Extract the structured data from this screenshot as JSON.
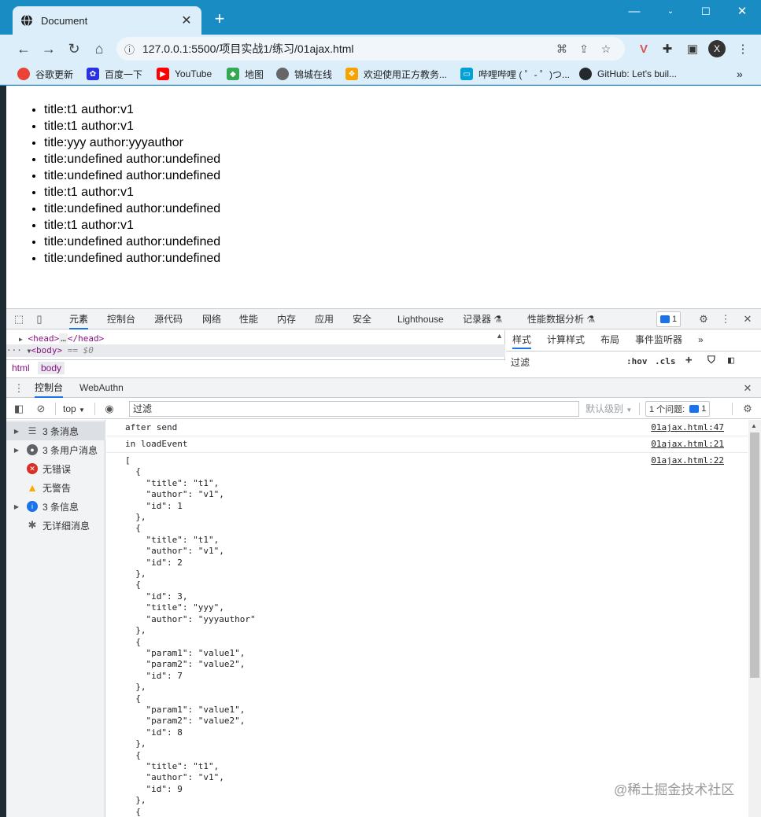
{
  "browser": {
    "tab_title": "Document",
    "tab_close": "✕",
    "new_tab": "+",
    "window_controls": {
      "minimize": "—",
      "maximize": "☐",
      "close": "✕"
    },
    "url": "127.0.0.1:5500/项目实战1/练习/01ajax.html",
    "profile_initial": "X",
    "bookmarks": [
      {
        "label": "谷歌更新"
      },
      {
        "label": "百度一下"
      },
      {
        "label": "YouTube"
      },
      {
        "label": "地图"
      },
      {
        "label": "锦城在线"
      },
      {
        "label": "欢迎使用正方教务..."
      },
      {
        "label": "哔哩哔哩 ( ゜- ゜)つ..."
      },
      {
        "label": "GitHub: Let's buil..."
      }
    ],
    "bookmarks_more": "»"
  },
  "page": {
    "items": [
      "title:t1 author:v1",
      "title:t1 author:v1",
      "title:yyy author:yyyauthor",
      "title:undefined author:undefined",
      "title:undefined author:undefined",
      "title:t1 author:v1",
      "title:undefined author:undefined",
      "title:t1 author:v1",
      "title:undefined author:undefined",
      "title:undefined author:undefined"
    ]
  },
  "devtools": {
    "tabs": [
      "元素",
      "控制台",
      "源代码",
      "网络",
      "性能",
      "内存",
      "应用",
      "安全",
      "Lighthouse",
      "记录器 ⚗",
      "性能数据分析 ⚗"
    ],
    "issues_count": "1",
    "elements": {
      "head_line_open": "<head>",
      "head_line_ellipsis": "…",
      "head_line_close": "</head>",
      "body_prefix": "···",
      "body_tag": "<body>",
      "body_suffix": "== $0",
      "crumbs": [
        "html",
        "body"
      ]
    },
    "styles": {
      "tabs": [
        "样式",
        "计算样式",
        "布局",
        "事件监听器",
        "»"
      ],
      "filter_placeholder": "过滤",
      "hov": ":hov",
      "cls": ".cls",
      "plus": "+"
    },
    "drawer": {
      "tabs": [
        "控制台",
        "WebAuthn"
      ],
      "close": "✕"
    },
    "console_toolbar": {
      "context": "top",
      "filter_placeholder": "过滤",
      "levels": "默认级别",
      "issues_label": "1 个问题:",
      "issues_count": "1"
    },
    "sidebar": [
      {
        "label": "3 条消息",
        "icon": "list-icon",
        "arrow": true
      },
      {
        "label": "3 条用户消息",
        "icon": "user-icon",
        "arrow": true
      },
      {
        "label": "无错误",
        "icon": "error-icon",
        "arrow": false
      },
      {
        "label": "无警告",
        "icon": "warning-icon",
        "arrow": false
      },
      {
        "label": "3 条信息",
        "icon": "info-icon",
        "arrow": true
      },
      {
        "label": "无详细消息",
        "icon": "verbose-icon",
        "arrow": false
      }
    ],
    "messages": [
      {
        "text": "after send",
        "source": "01ajax.html:47"
      },
      {
        "text": "in loadEvent",
        "source": "01ajax.html:21"
      },
      {
        "text": "[\n  {\n    \"title\": \"t1\",\n    \"author\": \"v1\",\n    \"id\": 1\n  },\n  {\n    \"title\": \"t1\",\n    \"author\": \"v1\",\n    \"id\": 2\n  },\n  {\n    \"id\": 3,\n    \"title\": \"yyy\",\n    \"author\": \"yyyauthor\"\n  },\n  {\n    \"param1\": \"value1\",\n    \"param2\": \"value2\",\n    \"id\": 7\n  },\n  {\n    \"param1\": \"value1\",\n    \"param2\": \"value2\",\n    \"id\": 8\n  },\n  {\n    \"title\": \"t1\",\n    \"author\": \"v1\",\n    \"id\": 9\n  },\n  {",
        "source": "01ajax.html:22"
      }
    ]
  },
  "watermark": "@稀土掘金技术社区",
  "colors": {
    "chrome_blue": "#1a8cc4",
    "toolbar": "#dbeefa",
    "accent": "#1a73e8",
    "tag": "#881280"
  }
}
